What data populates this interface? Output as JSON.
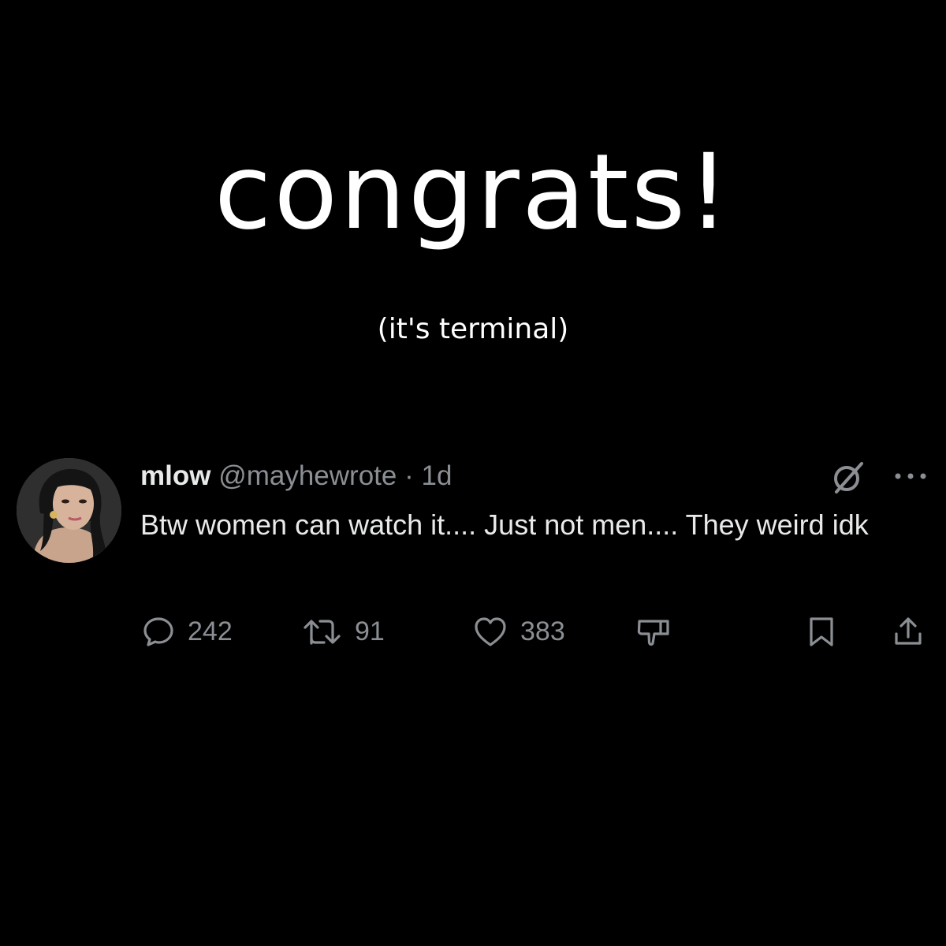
{
  "headline": "congrats!",
  "subline": "(it's terminal)",
  "tweet": {
    "display_name": "mlow",
    "handle": "@mayhewrote",
    "separator": "·",
    "age": "1d",
    "text": "Btw women can watch it.... Just not men.... They weird idk",
    "actions": {
      "replies": "242",
      "reposts": "91",
      "likes": "383"
    }
  },
  "icons": {
    "avatar": "profile-photo",
    "community_note": "slashed-circle-icon",
    "more": "more-icon",
    "reply": "reply-icon",
    "repost": "repost-icon",
    "like": "heart-icon",
    "dislike": "thumbs-down-icon",
    "bookmark": "bookmark-icon",
    "share": "share-icon"
  },
  "colors": {
    "background": "#000000",
    "primary_text": "#e7e9ea",
    "secondary_text": "#8b8f94",
    "headline_text": "#ffffff"
  }
}
